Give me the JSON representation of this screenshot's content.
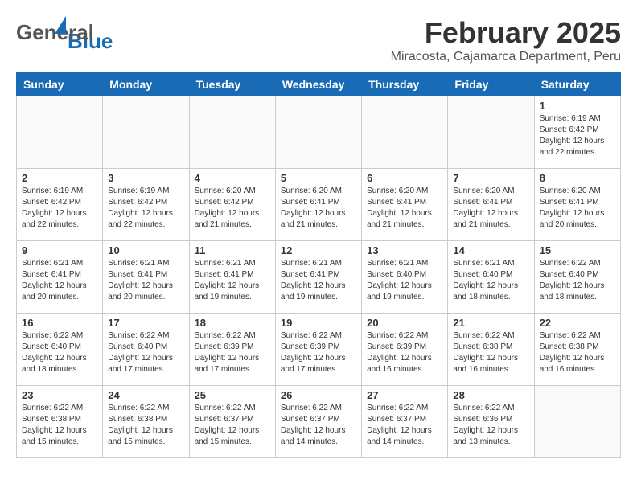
{
  "header": {
    "logo_general": "General",
    "logo_blue": "Blue",
    "title": "February 2025",
    "subtitle": "Miracosta, Cajamarca Department, Peru"
  },
  "calendar": {
    "days_of_week": [
      "Sunday",
      "Monday",
      "Tuesday",
      "Wednesday",
      "Thursday",
      "Friday",
      "Saturday"
    ],
    "weeks": [
      [
        {
          "day": "",
          "info": ""
        },
        {
          "day": "",
          "info": ""
        },
        {
          "day": "",
          "info": ""
        },
        {
          "day": "",
          "info": ""
        },
        {
          "day": "",
          "info": ""
        },
        {
          "day": "",
          "info": ""
        },
        {
          "day": "1",
          "info": "Sunrise: 6:19 AM\nSunset: 6:42 PM\nDaylight: 12 hours and 22 minutes."
        }
      ],
      [
        {
          "day": "2",
          "info": "Sunrise: 6:19 AM\nSunset: 6:42 PM\nDaylight: 12 hours and 22 minutes."
        },
        {
          "day": "3",
          "info": "Sunrise: 6:19 AM\nSunset: 6:42 PM\nDaylight: 12 hours and 22 minutes."
        },
        {
          "day": "4",
          "info": "Sunrise: 6:20 AM\nSunset: 6:42 PM\nDaylight: 12 hours and 21 minutes."
        },
        {
          "day": "5",
          "info": "Sunrise: 6:20 AM\nSunset: 6:41 PM\nDaylight: 12 hours and 21 minutes."
        },
        {
          "day": "6",
          "info": "Sunrise: 6:20 AM\nSunset: 6:41 PM\nDaylight: 12 hours and 21 minutes."
        },
        {
          "day": "7",
          "info": "Sunrise: 6:20 AM\nSunset: 6:41 PM\nDaylight: 12 hours and 21 minutes."
        },
        {
          "day": "8",
          "info": "Sunrise: 6:20 AM\nSunset: 6:41 PM\nDaylight: 12 hours and 20 minutes."
        }
      ],
      [
        {
          "day": "9",
          "info": "Sunrise: 6:21 AM\nSunset: 6:41 PM\nDaylight: 12 hours and 20 minutes."
        },
        {
          "day": "10",
          "info": "Sunrise: 6:21 AM\nSunset: 6:41 PM\nDaylight: 12 hours and 20 minutes."
        },
        {
          "day": "11",
          "info": "Sunrise: 6:21 AM\nSunset: 6:41 PM\nDaylight: 12 hours and 19 minutes."
        },
        {
          "day": "12",
          "info": "Sunrise: 6:21 AM\nSunset: 6:41 PM\nDaylight: 12 hours and 19 minutes."
        },
        {
          "day": "13",
          "info": "Sunrise: 6:21 AM\nSunset: 6:40 PM\nDaylight: 12 hours and 19 minutes."
        },
        {
          "day": "14",
          "info": "Sunrise: 6:21 AM\nSunset: 6:40 PM\nDaylight: 12 hours and 18 minutes."
        },
        {
          "day": "15",
          "info": "Sunrise: 6:22 AM\nSunset: 6:40 PM\nDaylight: 12 hours and 18 minutes."
        }
      ],
      [
        {
          "day": "16",
          "info": "Sunrise: 6:22 AM\nSunset: 6:40 PM\nDaylight: 12 hours and 18 minutes."
        },
        {
          "day": "17",
          "info": "Sunrise: 6:22 AM\nSunset: 6:40 PM\nDaylight: 12 hours and 17 minutes."
        },
        {
          "day": "18",
          "info": "Sunrise: 6:22 AM\nSunset: 6:39 PM\nDaylight: 12 hours and 17 minutes."
        },
        {
          "day": "19",
          "info": "Sunrise: 6:22 AM\nSunset: 6:39 PM\nDaylight: 12 hours and 17 minutes."
        },
        {
          "day": "20",
          "info": "Sunrise: 6:22 AM\nSunset: 6:39 PM\nDaylight: 12 hours and 16 minutes."
        },
        {
          "day": "21",
          "info": "Sunrise: 6:22 AM\nSunset: 6:38 PM\nDaylight: 12 hours and 16 minutes."
        },
        {
          "day": "22",
          "info": "Sunrise: 6:22 AM\nSunset: 6:38 PM\nDaylight: 12 hours and 16 minutes."
        }
      ],
      [
        {
          "day": "23",
          "info": "Sunrise: 6:22 AM\nSunset: 6:38 PM\nDaylight: 12 hours and 15 minutes."
        },
        {
          "day": "24",
          "info": "Sunrise: 6:22 AM\nSunset: 6:38 PM\nDaylight: 12 hours and 15 minutes."
        },
        {
          "day": "25",
          "info": "Sunrise: 6:22 AM\nSunset: 6:37 PM\nDaylight: 12 hours and 15 minutes."
        },
        {
          "day": "26",
          "info": "Sunrise: 6:22 AM\nSunset: 6:37 PM\nDaylight: 12 hours and 14 minutes."
        },
        {
          "day": "27",
          "info": "Sunrise: 6:22 AM\nSunset: 6:37 PM\nDaylight: 12 hours and 14 minutes."
        },
        {
          "day": "28",
          "info": "Sunrise: 6:22 AM\nSunset: 6:36 PM\nDaylight: 12 hours and 13 minutes."
        },
        {
          "day": "",
          "info": ""
        }
      ]
    ]
  }
}
